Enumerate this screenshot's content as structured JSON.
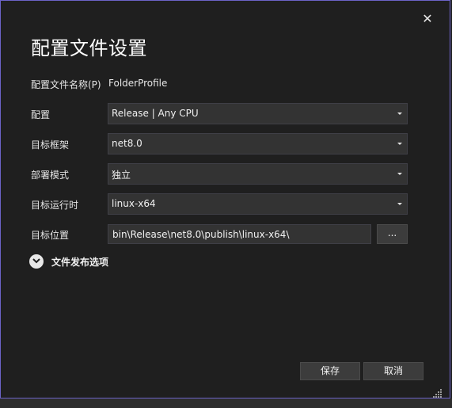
{
  "dialog": {
    "title": "配置文件设置",
    "close_icon": "close-icon",
    "close_glyph": "✕"
  },
  "fields": {
    "profile_name_label": "配置文件名称(P)",
    "profile_name_value": "FolderProfile",
    "configuration_label": "配置",
    "configuration_value": "Release | Any CPU",
    "target_framework_label": "目标框架",
    "target_framework_value": "net8.0",
    "deployment_mode_label": "部署模式",
    "deployment_mode_value": "独立",
    "target_runtime_label": "目标运行时",
    "target_runtime_value": "linux-x64",
    "target_location_label": "目标位置",
    "target_location_value": "bin\\Release\\net8.0\\publish\\linux-x64\\",
    "browse_label": "..."
  },
  "options": {
    "expander_label": "文件发布选项",
    "expander_icon": "chevron-down-icon"
  },
  "buttons": {
    "save_label": "保存",
    "cancel_label": "取消"
  },
  "colors": {
    "accent_border": "#6c63c7",
    "background": "#1f1f1f",
    "control_background": "#333333"
  }
}
